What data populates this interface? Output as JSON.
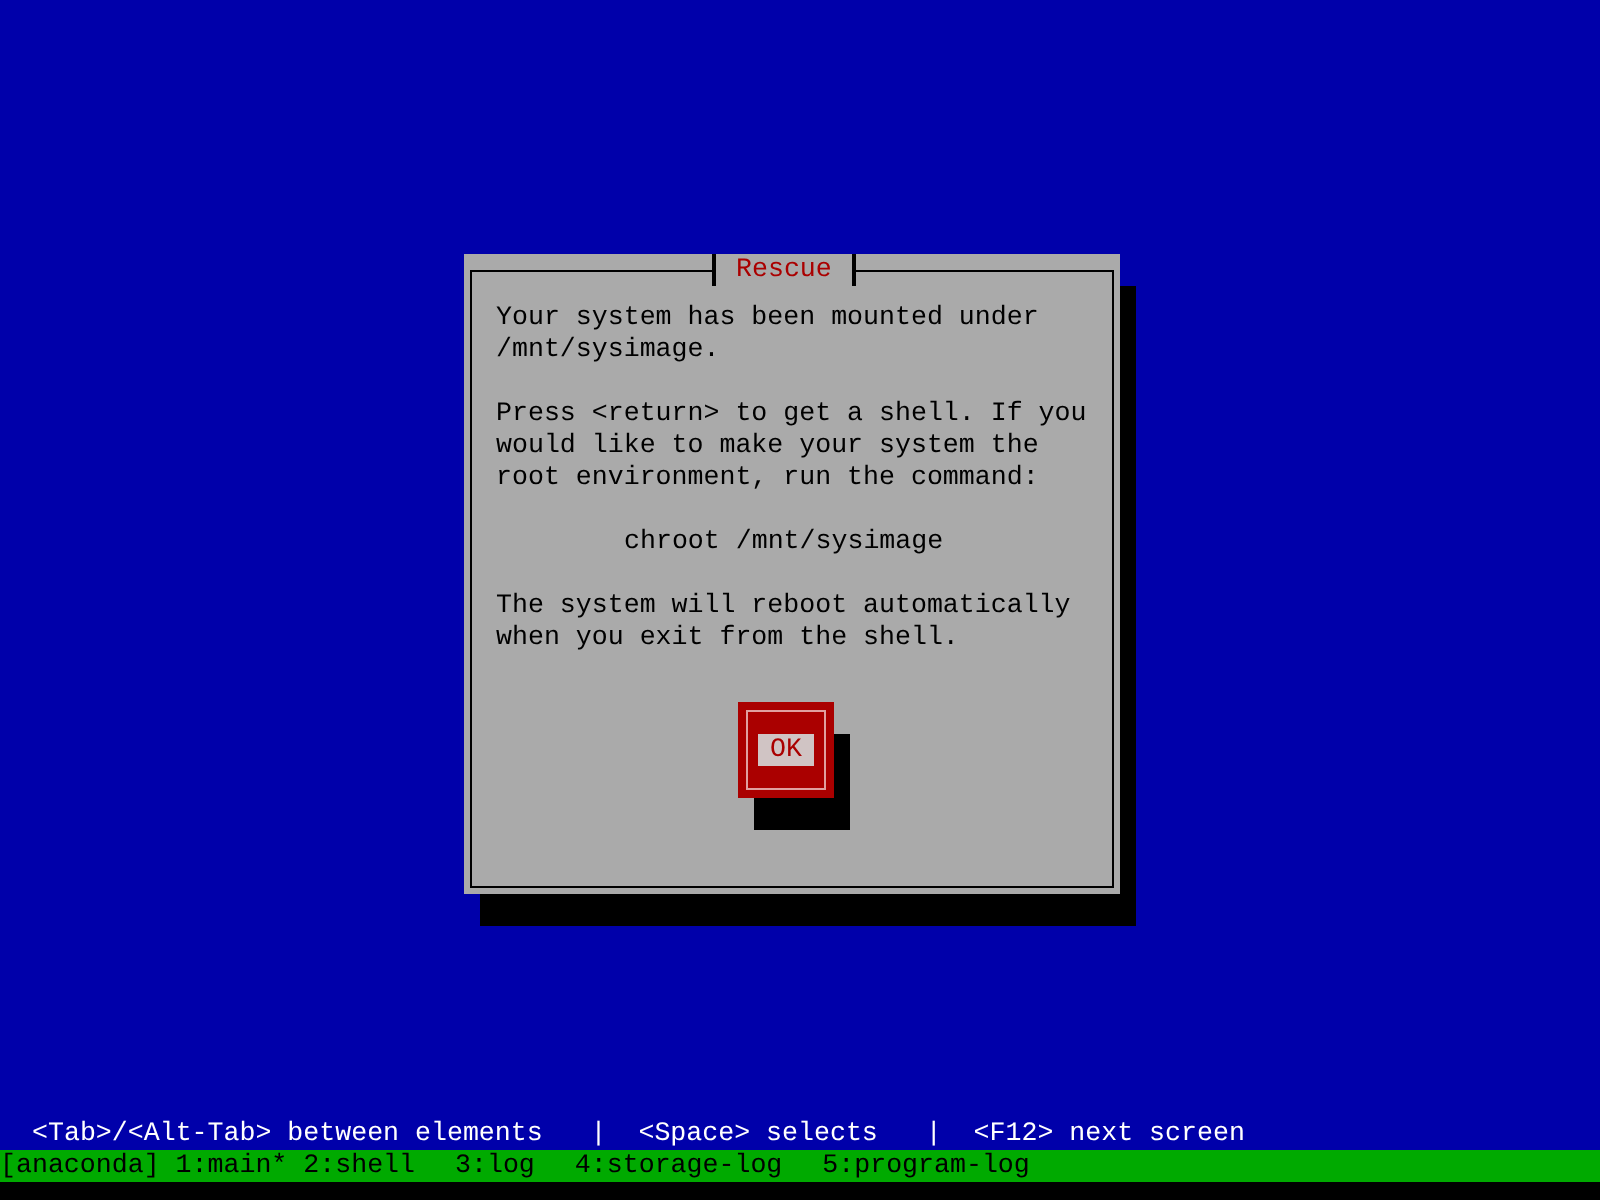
{
  "dialog": {
    "title": "Rescue",
    "paragraphs": [
      {
        "kind": "text",
        "lines": [
          "Your system has been mounted under",
          "/mnt/sysimage."
        ]
      },
      {
        "kind": "text",
        "lines": [
          "Press <return> to get a shell. If you",
          "would like to make your system the",
          "root environment, run the command:"
        ]
      },
      {
        "kind": "command",
        "lines": [
          "chroot /mnt/sysimage"
        ]
      },
      {
        "kind": "text",
        "lines": [
          "The system will reboot automatically",
          "when you exit from the shell."
        ]
      }
    ],
    "button": {
      "label": "OK",
      "focused": true
    }
  },
  "help_line": "<Tab>/<Alt-Tab> between elements   |  <Space> selects   |  <F12> next screen",
  "status_bar": {
    "session": "[anaconda]",
    "windows": [
      "1:main*",
      "2:shell",
      "3:log",
      "4:storage-log",
      "5:program-log"
    ]
  }
}
